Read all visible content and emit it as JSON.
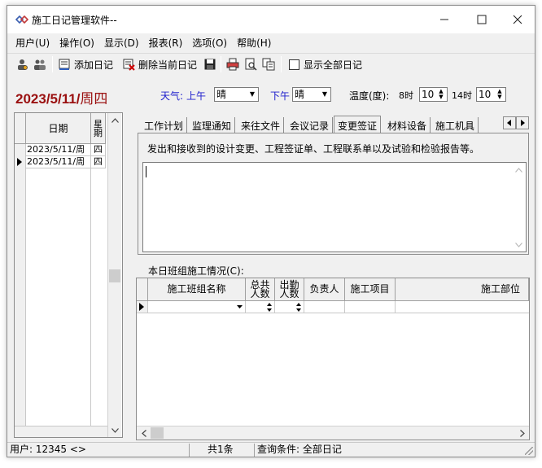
{
  "window": {
    "title": "施工日记管理软件--"
  },
  "menu": [
    {
      "label": "用户(U)"
    },
    {
      "label": "操作(O)"
    },
    {
      "label": "显示(D)"
    },
    {
      "label": "报表(R)"
    },
    {
      "label": "选项(O)"
    },
    {
      "label": "帮助(H)"
    }
  ],
  "toolbar": {
    "add_label": "添加日记",
    "delete_label": "删除当前日记",
    "show_all_label": "显示全部日记",
    "show_all_checked": false
  },
  "current_date": {
    "date": "2023/5/11/",
    "weekday": "周四"
  },
  "weather": {
    "label": "天气:",
    "am_label": "上午",
    "am_value": "晴",
    "pm_label": "下午",
    "pm_value": "晴",
    "temp_label": "温度(度):",
    "t1_label": "8时",
    "t1_value": "10",
    "t2_label": "14时",
    "t2_value": "10"
  },
  "date_list": {
    "col_date": "日期",
    "col_weekday": "星期",
    "rows": [
      {
        "date": "2023/5/11/周",
        "weekday": "四",
        "current": false
      },
      {
        "date": "2023/5/11/周",
        "weekday": "四",
        "current": true
      }
    ]
  },
  "tabs": [
    {
      "label": "工作计划",
      "active": false
    },
    {
      "label": "监理通知",
      "active": false
    },
    {
      "label": "来往文件",
      "active": false
    },
    {
      "label": "会议记录",
      "active": false
    },
    {
      "label": "变更签证",
      "active": true
    },
    {
      "label": "材料设备",
      "active": false
    },
    {
      "label": "施工机具",
      "active": false
    }
  ],
  "tab_panel": {
    "description": "发出和接收到的设计变更、工程签证单、工程联系单以及试验和检验报告等。",
    "memo_text": ""
  },
  "crew": {
    "label": "本日班组施工情况(C):",
    "columns": [
      "施工班组名称",
      "总共人数",
      "出勤人数",
      "负责人",
      "施工项目",
      "施工部位"
    ]
  },
  "status": {
    "user": "用户: 12345 <>",
    "count": "共1条",
    "query": "查询条件: 全部日记"
  },
  "colors": {
    "date_accent": "#9a1010",
    "weather_label": "#1a1acc"
  }
}
